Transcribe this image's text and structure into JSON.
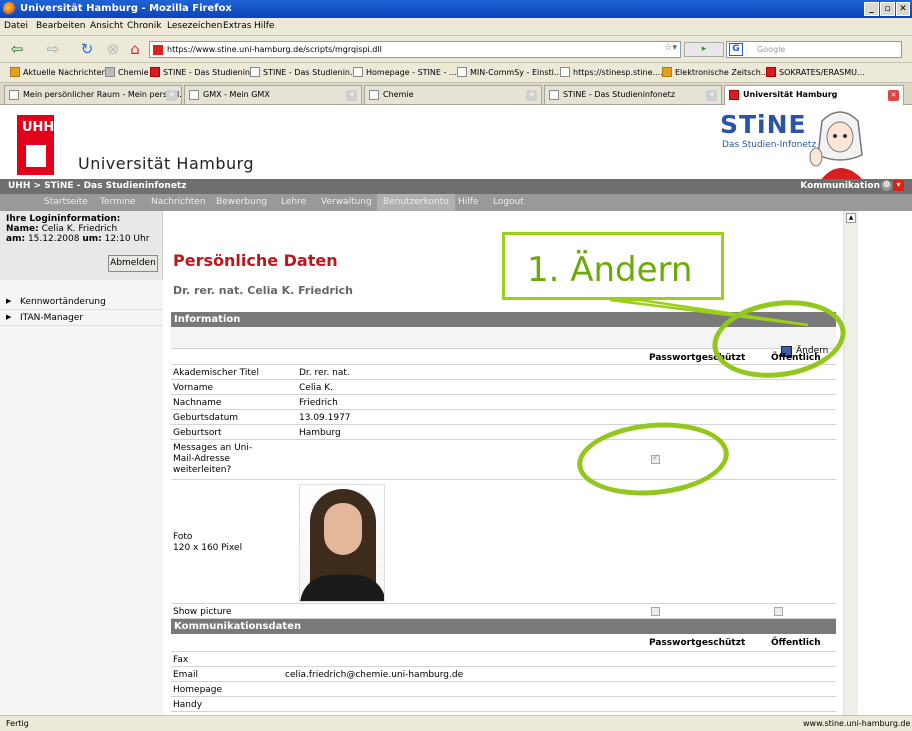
{
  "window": {
    "title": "Universität Hamburg - Mozilla Firefox"
  },
  "menu": [
    "Datei",
    "Bearbeiten",
    "Ansicht",
    "Chronik",
    "Lesezeichen",
    "Extras",
    "Hilfe"
  ],
  "address": {
    "url": "https://www.stine.uni-hamburg.de/scripts/mgrqispi.dll"
  },
  "search": {
    "placeholder": "Google"
  },
  "bookmarks": [
    "Aktuelle Nachrichten",
    "Chemie",
    "STINE - Das Studienin...",
    "STINE - Das Studienin...",
    "Homepage - STINE - ...",
    "MIN-CommSy - Einsti...",
    "https://stinesp.stine....",
    "Elektronische Zeitsch...",
    "SOKRATES/ERASMU..."
  ],
  "tabs": [
    "Mein persönlicher Raum - Mein persönl...",
    "GMX - Mein GMX",
    "Chemie",
    "STINE - Das Studieninfonetz",
    "Universität Hamburg"
  ],
  "site": {
    "logo_text": "UHH",
    "uni_name": "Universität Hamburg",
    "brand": "STiNE",
    "brand_sub": "Das Studien-Infonetz",
    "crumb": "UHH > STiNE - Das Studieninfonetz",
    "kommunikation": "Kommunikation",
    "nav": [
      "Startseite",
      "Termine",
      "Nachrichten",
      "Bewerbung",
      "Lehre",
      "Verwaltung",
      "Benutzerkonto",
      "Hilfe",
      "Logout"
    ]
  },
  "login": {
    "title": "Ihre Logininformation:",
    "name_label": "Name:",
    "name": "Celia K. Friedrich",
    "am_label": "am:",
    "date": "15.12.2008",
    "um_label": "um:",
    "time": "12:10 Uhr",
    "logout_button": "Abmelden"
  },
  "leftmenu": [
    "Kennwortänderung",
    "ITAN-Manager"
  ],
  "main": {
    "title": "Persönliche Daten",
    "subtitle": "Dr. rer. nat. Celia K. Friedrich",
    "callout": "1. Ändern",
    "section_info": "Information",
    "edit_label": "Ändern",
    "col_pw": "Passwortgeschützt",
    "col_public": "Öffentlich",
    "info_rows": [
      {
        "label": "Akademischer Titel",
        "value": "Dr. rer. nat."
      },
      {
        "label": "Vorname",
        "value": "Celia K."
      },
      {
        "label": "Nachname",
        "value": "Friedrich"
      },
      {
        "label": "Geburtsdatum",
        "value": "13.09.1977"
      },
      {
        "label": "Geburtsort",
        "value": "Hamburg"
      }
    ],
    "messages_label": "Messages an Uni-Mail-Adresse weiterleiten?",
    "messages_checked": true,
    "foto_label": "Foto",
    "foto_size": "120 x 160 Pixel",
    "show_picture": "Show picture",
    "section_comm": "Kommunikationsdaten",
    "comm_rows": [
      {
        "label": "Fax",
        "value": ""
      },
      {
        "label": "Email",
        "value": "celia.friedrich@chemie.uni-hamburg.de"
      },
      {
        "label": "Homepage",
        "value": ""
      },
      {
        "label": "Handy",
        "value": ""
      }
    ]
  },
  "status": {
    "left": "Fertig",
    "domain": "www.stine.uni-hamburg.de"
  },
  "colors": {
    "accent_red": "#c0161b",
    "highlight_green": "#94c71d",
    "brand_blue": "#2a54a6"
  }
}
